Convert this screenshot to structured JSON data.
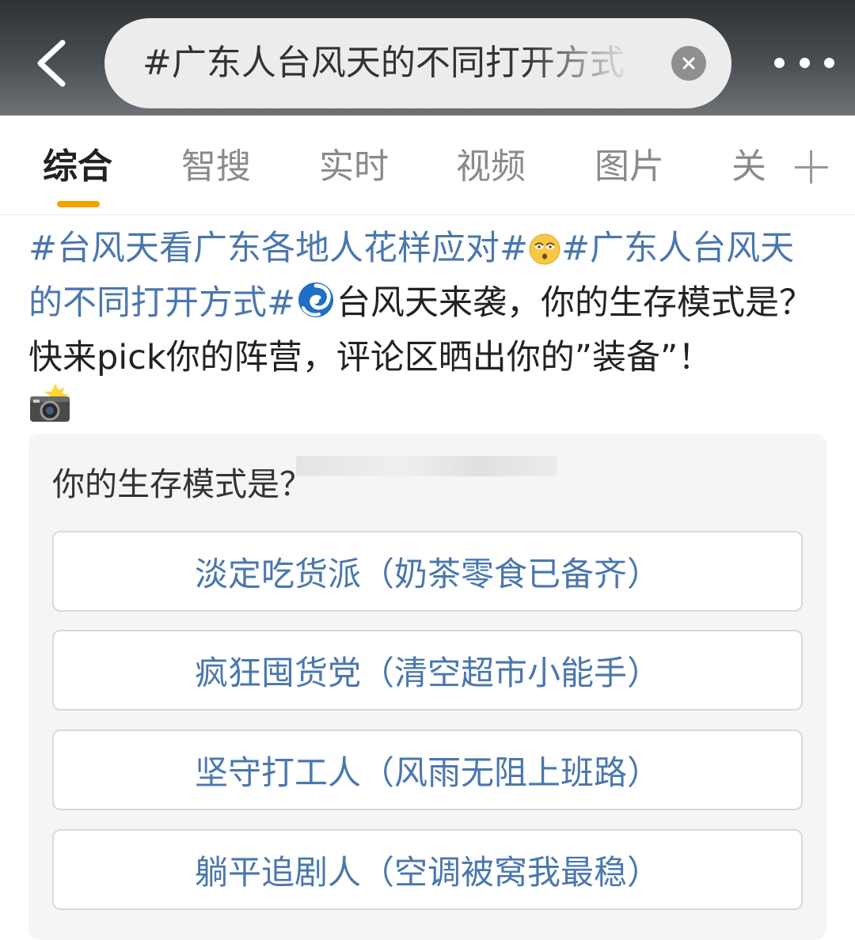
{
  "header": {
    "search_query": "#广东人台风天的不同打开方式",
    "back_icon": "chevron-left-icon",
    "clear_icon": "close-icon",
    "more_icon": "more-dots-icon"
  },
  "tabs": [
    {
      "label": "综合",
      "active": true
    },
    {
      "label": "智搜",
      "active": false
    },
    {
      "label": "实时",
      "active": false
    },
    {
      "label": "视频",
      "active": false
    },
    {
      "label": "图片",
      "active": false
    },
    {
      "label": "关",
      "active": false
    }
  ],
  "tab_accent_color": "#f5a000",
  "post": {
    "topic1": "#台风天看广东各地人花样应对#",
    "emoji1": "rolling-eyes-emoji",
    "topic2": "#广东人台风天的不同打开方式#",
    "emoji2": "cyclone-emoji",
    "text1": "台风天来袭，你的生存模式是？快来pick你的阵营，评论区晒出你的”装备”！",
    "emoji3": "camera-flash-emoji"
  },
  "poll": {
    "question": "你的生存模式是？",
    "options": [
      "淡定吃货派（奶茶零食已备齐）",
      "疯狂囤货党（清空超市小能手）",
      "坚守打工人（风雨无阻上班路）",
      "躺平追剧人（空调被窝我最稳）"
    ]
  },
  "colors": {
    "topic_link": "#4a77ad",
    "option_text": "#4a77ad"
  }
}
